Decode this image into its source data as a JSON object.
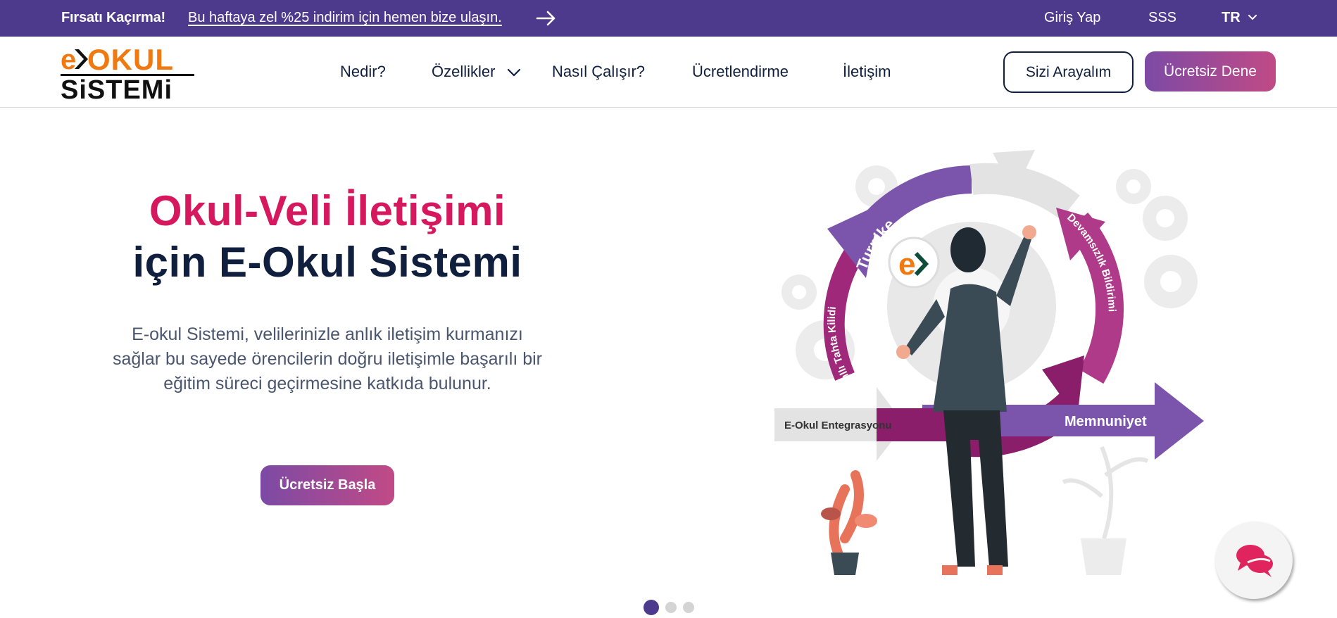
{
  "topbar": {
    "promo_title": "Fırsatı Kaçırma!",
    "promo_link": "Bu haftaya zel %25 indirim için hemen bize ulaşın.",
    "login": "Giriş Yap",
    "faq": "SSS",
    "language": "TR"
  },
  "logo": {
    "letter": "e",
    "word_top": "OKUL",
    "word_bottom": "SiSTEMi"
  },
  "nav": {
    "items": [
      "Nedir?",
      "Özellikler",
      "Nasıl Çalışır?",
      "Ücretlendirme",
      "İletişim"
    ],
    "call_me": "Sizi Arayalım",
    "free_trial": "Ücretsiz Dene"
  },
  "hero": {
    "title_line1": "Okul-Veli İletişimi",
    "title_line2": "için E-Okul Sistemi",
    "description": "E-okul Sistemi, velilerinizle anlık iletişim kurmanızı sağlar bu sayede örencilerin doğru iletişimle başarılı bir eğitim süreci geçirmesine katkıda bulunur.",
    "cta": "Ücretsiz Başla"
  },
  "illustration": {
    "labels": [
      "Turnike",
      "Devamsızlık Bildirimi",
      "Akıllı Tahta Kilidi",
      "E-Okul Entegrasyonu",
      "Memnuniyet"
    ],
    "badge": "e"
  },
  "slider": {
    "total": 3,
    "active": 1
  },
  "colors": {
    "brand_purple": "#4e3a8d",
    "accent_pink": "#d6195f",
    "navy": "#0f1f3d",
    "logo_orange": "#f07a10"
  }
}
